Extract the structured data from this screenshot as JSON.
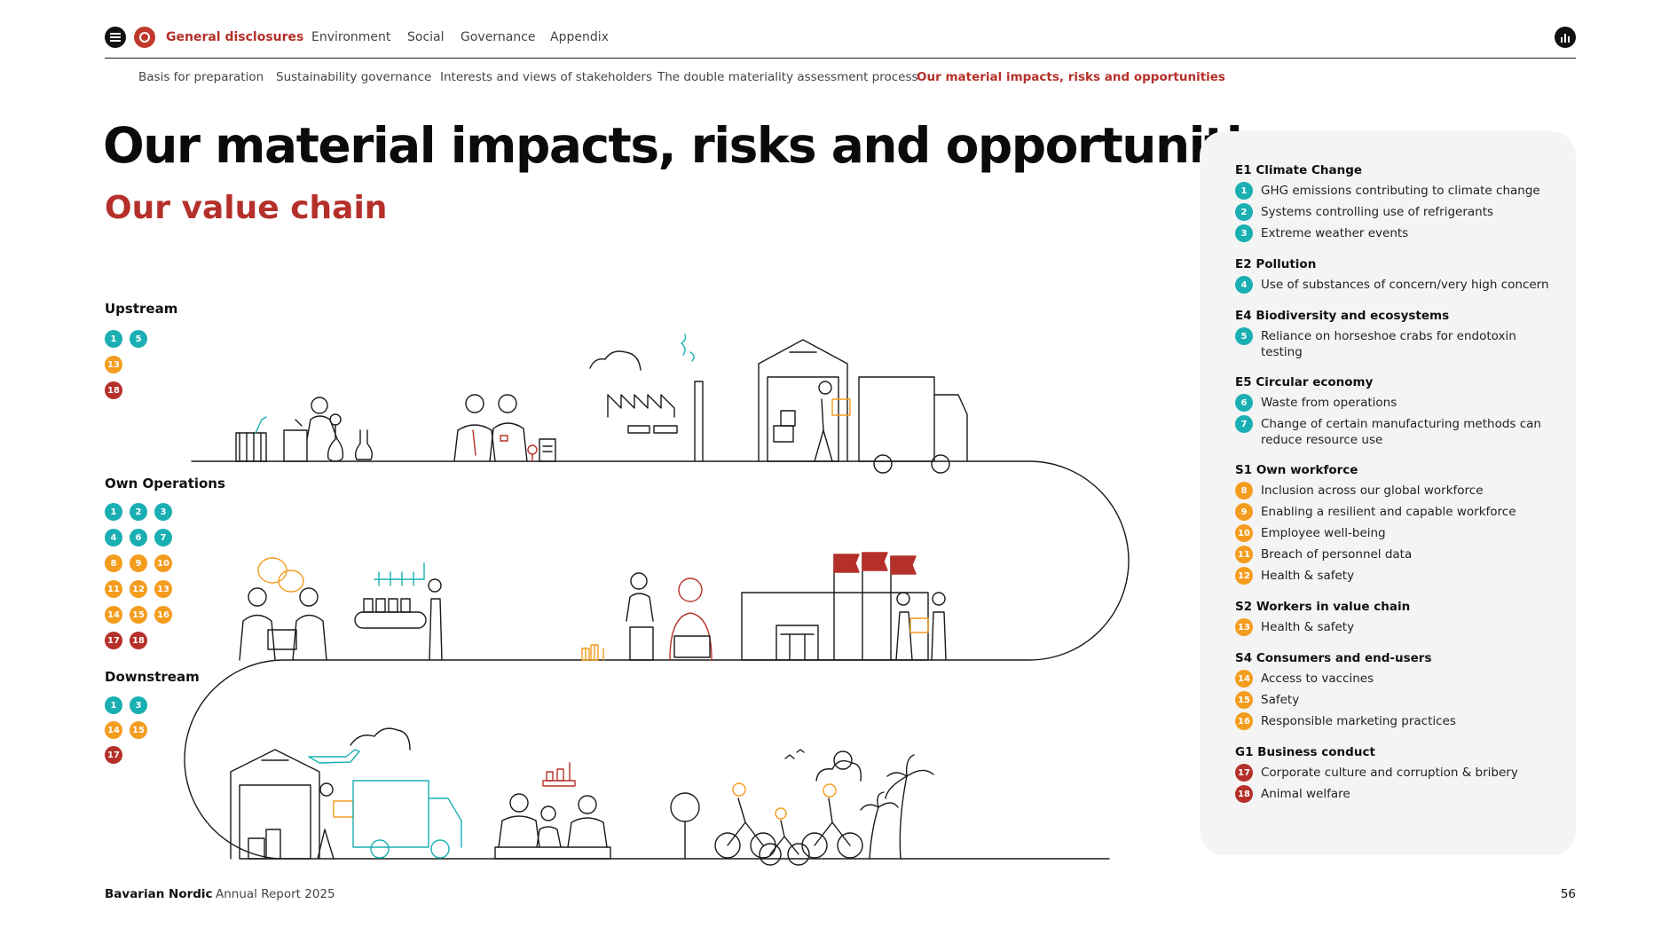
{
  "topnav": {
    "items": [
      {
        "label": "General disclosures",
        "active": true
      },
      {
        "label": "Environment",
        "active": false
      },
      {
        "label": "Social",
        "active": false
      },
      {
        "label": "Governance",
        "active": false
      },
      {
        "label": "Appendix",
        "active": false
      }
    ],
    "menu_icon": "hamburger-menu-icon",
    "stats_icon": "bar-chart-icon"
  },
  "subnav": {
    "items": [
      {
        "label": "Basis for preparation",
        "active": false
      },
      {
        "label": "Sustainability governance",
        "active": false
      },
      {
        "label": "Interests and views of stakeholders",
        "active": false
      },
      {
        "label": "The double materiality assessment process",
        "active": false
      },
      {
        "label": "Our material impacts, risks and opportunities",
        "active": true
      }
    ]
  },
  "title": "Our material impacts, risks and opportunities",
  "subtitle": "Our value chain",
  "stages": {
    "upstream": {
      "label": "Upstream",
      "rows": [
        [
          "1",
          "5"
        ],
        [
          "13"
        ],
        [
          "18"
        ]
      ]
    },
    "own_operations": {
      "label": "Own Operations",
      "rows": [
        [
          "1",
          "2",
          "3"
        ],
        [
          "4",
          "6",
          "7"
        ],
        [
          "8",
          "9",
          "10"
        ],
        [
          "11",
          "12",
          "13"
        ],
        [
          "14",
          "15",
          "16"
        ],
        [
          "17",
          "18"
        ]
      ]
    },
    "downstream": {
      "label": "Downstream",
      "rows": [
        [
          "1",
          "3"
        ],
        [
          "14",
          "15"
        ],
        [
          "17"
        ]
      ]
    }
  },
  "panel": {
    "categories": [
      {
        "title": "E1 Climate Change",
        "items": [
          {
            "num": "1",
            "text": "GHG emissions contributing to climate change"
          },
          {
            "num": "2",
            "text": "Systems controlling use of refrigerants"
          },
          {
            "num": "3",
            "text": "Extreme weather events"
          }
        ]
      },
      {
        "title": "E2 Pollution",
        "items": [
          {
            "num": "4",
            "text": "Use of substances of concern/very high concern"
          }
        ]
      },
      {
        "title": "E4 Biodiversity and ecosystems",
        "items": [
          {
            "num": "5",
            "text": "Reliance on horseshoe crabs for endotoxin testing"
          }
        ]
      },
      {
        "title": "E5 Circular economy",
        "items": [
          {
            "num": "6",
            "text": "Waste from operations"
          },
          {
            "num": "7",
            "text": "Change of certain manufacturing methods can reduce resource use"
          }
        ]
      },
      {
        "title": "S1 Own workforce",
        "items": [
          {
            "num": "8",
            "text": "Inclusion across our global workforce"
          },
          {
            "num": "9",
            "text": "Enabling a resilient and capable workforce"
          },
          {
            "num": "10",
            "text": "Employee well-being"
          },
          {
            "num": "11",
            "text": "Breach of personnel data"
          },
          {
            "num": "12",
            "text": "Health & safety"
          }
        ]
      },
      {
        "title": "S2 Workers in value chain",
        "items": [
          {
            "num": "13",
            "text": "Health & safety"
          }
        ]
      },
      {
        "title": "S4 Consumers and end-users",
        "items": [
          {
            "num": "14",
            "text": "Access to vaccines"
          },
          {
            "num": "15",
            "text": "Safety"
          },
          {
            "num": "16",
            "text": "Responsible marketing practices"
          }
        ]
      },
      {
        "title": "G1 Business conduct",
        "items": [
          {
            "num": "17",
            "text": "Corporate culture and corruption & bribery"
          },
          {
            "num": "18",
            "text": "Animal welfare"
          }
        ]
      }
    ]
  },
  "colors": {
    "environment": "#1aafb2",
    "social": "#f39c1e",
    "governance": "#b5302a",
    "accent": "#b5302a"
  },
  "footer": {
    "brand": "Bavarian Nordic",
    "report": "Annual Report 2025",
    "page": "56"
  }
}
